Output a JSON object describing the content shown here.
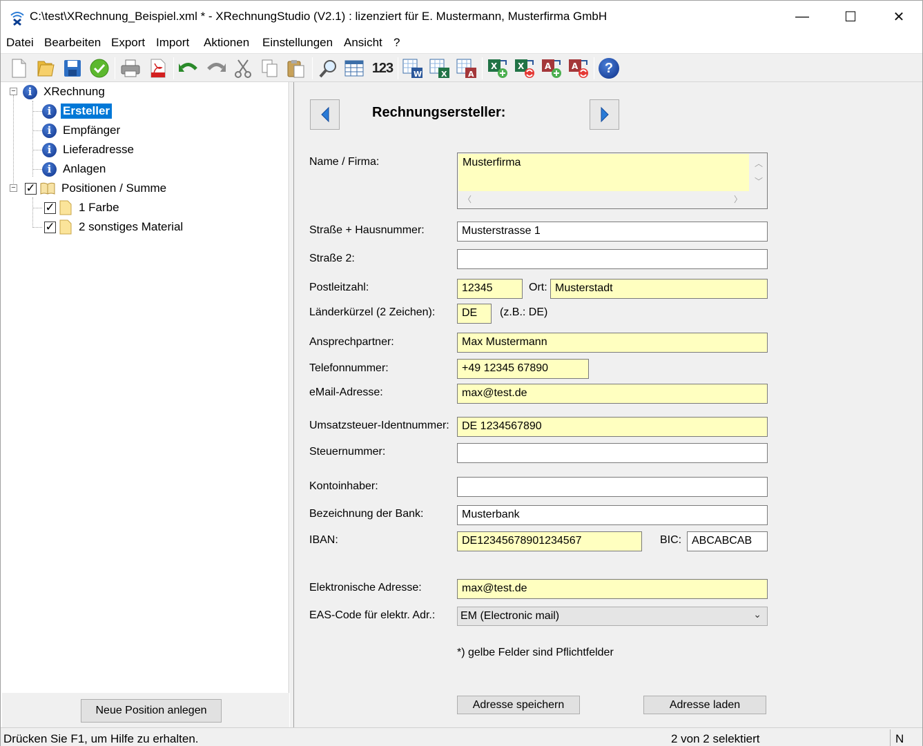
{
  "window": {
    "title": "C:\\test\\XRechnung_Beispiel.xml * - XRechnungStudio (V2.1) : lizenziert für E. Mustermann, Musterfirma GmbH",
    "minimize": "—",
    "maximize": "☐",
    "close": "✕"
  },
  "menu": [
    "Datei",
    "Bearbeiten",
    "Export",
    "Import",
    "Aktionen",
    "Einstellungen",
    "Ansicht",
    "?"
  ],
  "toolbar": {
    "icons": [
      "new-document-icon",
      "open-folder-icon",
      "save-icon",
      "validate-icon",
      "print-icon",
      "pdf-icon",
      "undo-icon",
      "redo-icon",
      "cut-icon",
      "copy-icon",
      "paste-icon",
      "search-icon",
      "table-icon",
      "numbering-icon",
      "export-word-icon",
      "export-excel-icon",
      "export-access-icon",
      "import-excel-add-icon",
      "import-excel-replace-icon",
      "import-access-add-icon",
      "import-access-replace-icon",
      "help-icon"
    ],
    "numbering_text": "123",
    "help_text": "?"
  },
  "tree": {
    "root": "XRechnung",
    "children": [
      "Ersteller",
      "Empfänger",
      "Lieferadresse",
      "Anlagen"
    ],
    "positions_node": "Positionen / Summe",
    "positions": [
      "1 Farbe",
      "2 sonstiges Material"
    ],
    "selected": "Ersteller",
    "new_position_button": "Neue Position anlegen"
  },
  "form": {
    "title": "Rechnungsersteller:",
    "labels": {
      "name": "Name / Firma:",
      "street": "Straße + Hausnummer:",
      "street2": "Straße 2:",
      "zip": "Postleitzahl:",
      "city": "Ort:",
      "country": "Länderkürzel (2 Zeichen):",
      "country_hint": "(z.B.: DE)",
      "contact": "Ansprechpartner:",
      "phone": "Telefonnummer:",
      "email": "eMail-Adresse:",
      "vat_id": "Umsatzsteuer-Identnummer:",
      "tax_no": "Steuernummer:",
      "account_holder": "Kontoinhaber:",
      "bank": "Bezeichnung der Bank:",
      "iban": "IBAN:",
      "bic": "BIC:",
      "e_address": "Elektronische Adresse:",
      "eas_code": "EAS-Code für elektr. Adr.:"
    },
    "values": {
      "name": "Musterfirma",
      "street": "Musterstrasse 1",
      "street2": "",
      "zip": "12345",
      "city": "Musterstadt",
      "country": "DE",
      "contact": "Max Mustermann",
      "phone": "+49 12345 67890",
      "email": "max@test.de",
      "vat_id": "DE 1234567890",
      "tax_no": "",
      "account_holder": "",
      "bank": "Musterbank",
      "iban": "DE12345678901234567",
      "bic": "ABCABCAB",
      "e_address": "max@test.de",
      "eas_code": "EM (Electronic mail)"
    },
    "required_note": "*) gelbe Felder sind Pflichtfelder",
    "save_button": "Adresse speichern",
    "load_button": "Adresse laden",
    "required_color": "#ffffc0"
  },
  "statusbar": {
    "help": "Drücken Sie F1, um Hilfe zu erhalten.",
    "selection": "2 von 2 selektiert",
    "mode": "N"
  }
}
